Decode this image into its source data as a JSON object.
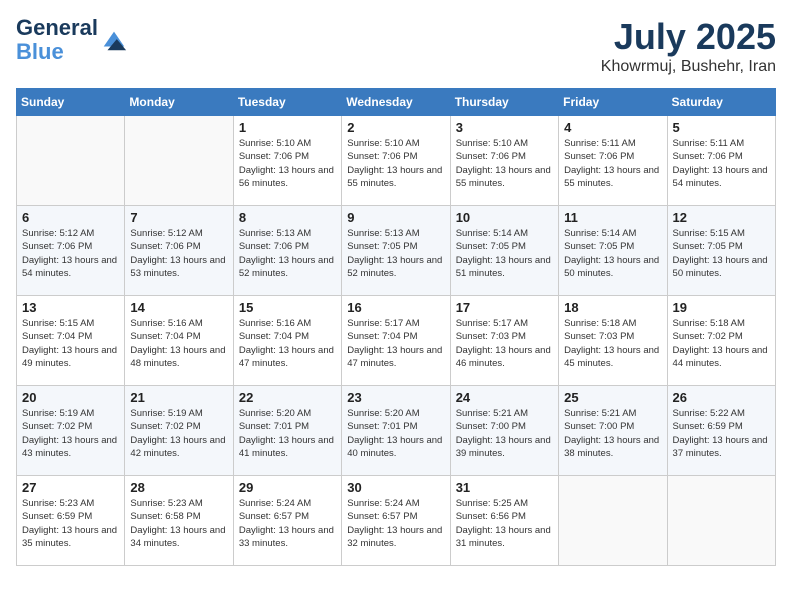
{
  "logo": {
    "line1": "General",
    "line2": "Blue"
  },
  "title": "July 2025",
  "location": "Khowrmuj, Bushehr, Iran",
  "days_of_week": [
    "Sunday",
    "Monday",
    "Tuesday",
    "Wednesday",
    "Thursday",
    "Friday",
    "Saturday"
  ],
  "weeks": [
    [
      {
        "day": "",
        "info": ""
      },
      {
        "day": "",
        "info": ""
      },
      {
        "day": "1",
        "sunrise": "5:10 AM",
        "sunset": "7:06 PM",
        "daylight": "13 hours and 56 minutes."
      },
      {
        "day": "2",
        "sunrise": "5:10 AM",
        "sunset": "7:06 PM",
        "daylight": "13 hours and 55 minutes."
      },
      {
        "day": "3",
        "sunrise": "5:10 AM",
        "sunset": "7:06 PM",
        "daylight": "13 hours and 55 minutes."
      },
      {
        "day": "4",
        "sunrise": "5:11 AM",
        "sunset": "7:06 PM",
        "daylight": "13 hours and 55 minutes."
      },
      {
        "day": "5",
        "sunrise": "5:11 AM",
        "sunset": "7:06 PM",
        "daylight": "13 hours and 54 minutes."
      }
    ],
    [
      {
        "day": "6",
        "sunrise": "5:12 AM",
        "sunset": "7:06 PM",
        "daylight": "13 hours and 54 minutes."
      },
      {
        "day": "7",
        "sunrise": "5:12 AM",
        "sunset": "7:06 PM",
        "daylight": "13 hours and 53 minutes."
      },
      {
        "day": "8",
        "sunrise": "5:13 AM",
        "sunset": "7:06 PM",
        "daylight": "13 hours and 52 minutes."
      },
      {
        "day": "9",
        "sunrise": "5:13 AM",
        "sunset": "7:05 PM",
        "daylight": "13 hours and 52 minutes."
      },
      {
        "day": "10",
        "sunrise": "5:14 AM",
        "sunset": "7:05 PM",
        "daylight": "13 hours and 51 minutes."
      },
      {
        "day": "11",
        "sunrise": "5:14 AM",
        "sunset": "7:05 PM",
        "daylight": "13 hours and 50 minutes."
      },
      {
        "day": "12",
        "sunrise": "5:15 AM",
        "sunset": "7:05 PM",
        "daylight": "13 hours and 50 minutes."
      }
    ],
    [
      {
        "day": "13",
        "sunrise": "5:15 AM",
        "sunset": "7:04 PM",
        "daylight": "13 hours and 49 minutes."
      },
      {
        "day": "14",
        "sunrise": "5:16 AM",
        "sunset": "7:04 PM",
        "daylight": "13 hours and 48 minutes."
      },
      {
        "day": "15",
        "sunrise": "5:16 AM",
        "sunset": "7:04 PM",
        "daylight": "13 hours and 47 minutes."
      },
      {
        "day": "16",
        "sunrise": "5:17 AM",
        "sunset": "7:04 PM",
        "daylight": "13 hours and 47 minutes."
      },
      {
        "day": "17",
        "sunrise": "5:17 AM",
        "sunset": "7:03 PM",
        "daylight": "13 hours and 46 minutes."
      },
      {
        "day": "18",
        "sunrise": "5:18 AM",
        "sunset": "7:03 PM",
        "daylight": "13 hours and 45 minutes."
      },
      {
        "day": "19",
        "sunrise": "5:18 AM",
        "sunset": "7:02 PM",
        "daylight": "13 hours and 44 minutes."
      }
    ],
    [
      {
        "day": "20",
        "sunrise": "5:19 AM",
        "sunset": "7:02 PM",
        "daylight": "13 hours and 43 minutes."
      },
      {
        "day": "21",
        "sunrise": "5:19 AM",
        "sunset": "7:02 PM",
        "daylight": "13 hours and 42 minutes."
      },
      {
        "day": "22",
        "sunrise": "5:20 AM",
        "sunset": "7:01 PM",
        "daylight": "13 hours and 41 minutes."
      },
      {
        "day": "23",
        "sunrise": "5:20 AM",
        "sunset": "7:01 PM",
        "daylight": "13 hours and 40 minutes."
      },
      {
        "day": "24",
        "sunrise": "5:21 AM",
        "sunset": "7:00 PM",
        "daylight": "13 hours and 39 minutes."
      },
      {
        "day": "25",
        "sunrise": "5:21 AM",
        "sunset": "7:00 PM",
        "daylight": "13 hours and 38 minutes."
      },
      {
        "day": "26",
        "sunrise": "5:22 AM",
        "sunset": "6:59 PM",
        "daylight": "13 hours and 37 minutes."
      }
    ],
    [
      {
        "day": "27",
        "sunrise": "5:23 AM",
        "sunset": "6:59 PM",
        "daylight": "13 hours and 35 minutes."
      },
      {
        "day": "28",
        "sunrise": "5:23 AM",
        "sunset": "6:58 PM",
        "daylight": "13 hours and 34 minutes."
      },
      {
        "day": "29",
        "sunrise": "5:24 AM",
        "sunset": "6:57 PM",
        "daylight": "13 hours and 33 minutes."
      },
      {
        "day": "30",
        "sunrise": "5:24 AM",
        "sunset": "6:57 PM",
        "daylight": "13 hours and 32 minutes."
      },
      {
        "day": "31",
        "sunrise": "5:25 AM",
        "sunset": "6:56 PM",
        "daylight": "13 hours and 31 minutes."
      },
      {
        "day": "",
        "info": ""
      },
      {
        "day": "",
        "info": ""
      }
    ]
  ]
}
